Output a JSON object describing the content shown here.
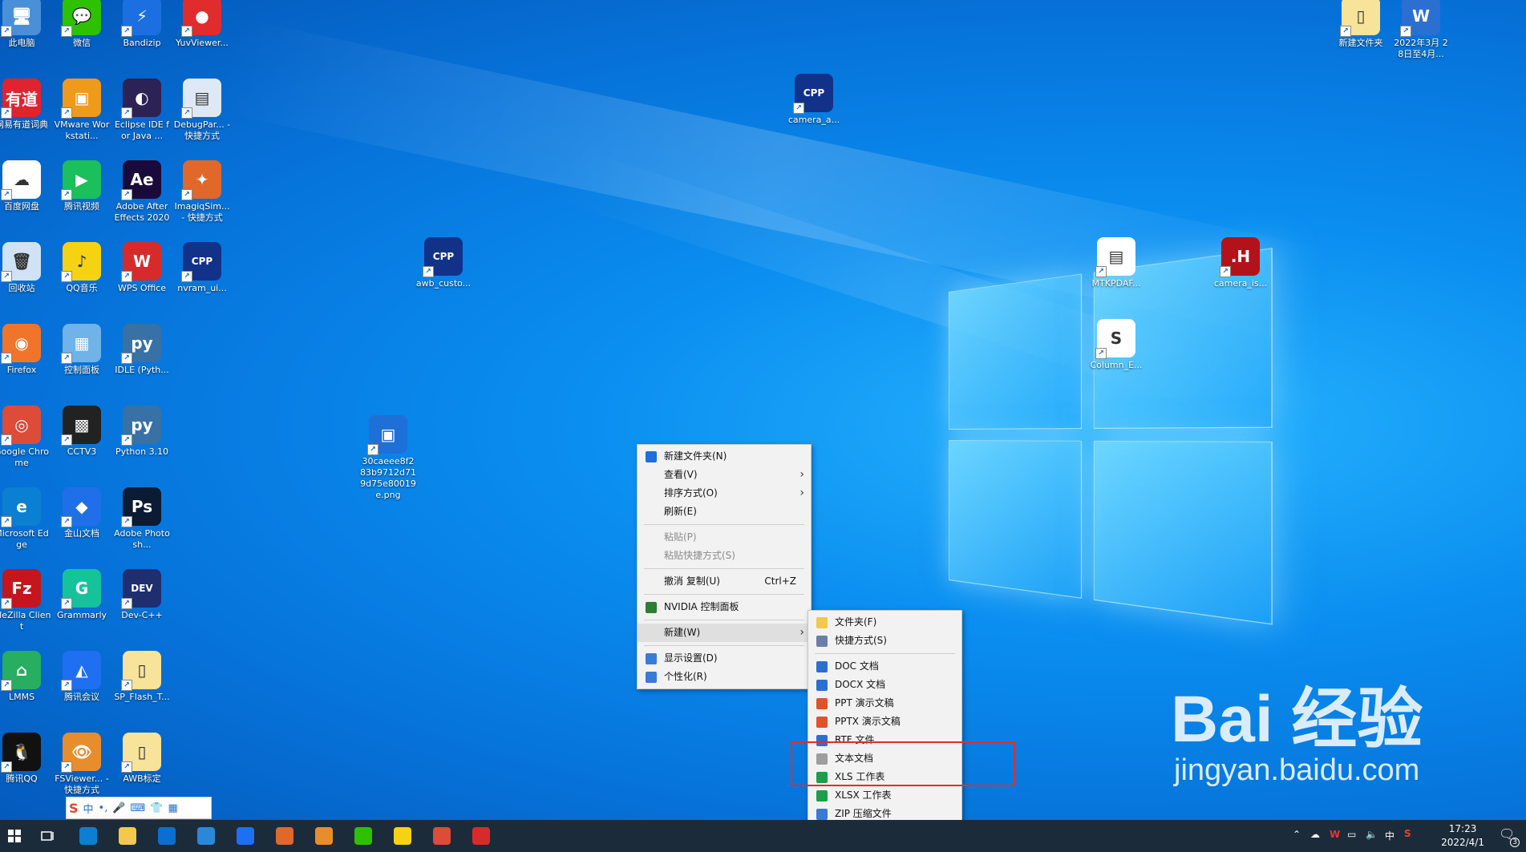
{
  "desktop_icons": [
    {
      "label": "此电脑",
      "color": "#4a90d9",
      "glyph": "🖥"
    },
    {
      "label": "微信",
      "color": "#2dc100",
      "glyph": "💬"
    },
    {
      "label": "Bandizip",
      "color": "#1c6fe0",
      "glyph": "⚡"
    },
    {
      "label": "YuvViewer...",
      "color": "#e02c2c",
      "glyph": "●"
    },
    {
      "label": "网易有道词典",
      "color": "#e0232e",
      "glyph": "有道"
    },
    {
      "label": "VMware Workstati...",
      "color": "#f09a1c",
      "glyph": "▣"
    },
    {
      "label": "Eclipse IDE for Java ...",
      "color": "#2c2255",
      "glyph": "◐"
    },
    {
      "label": "DebugPar... - 快捷方式",
      "color": "#dfe8f5",
      "glyph": "▤"
    },
    {
      "label": "百度网盘",
      "color": "#ffffff",
      "glyph": "☁"
    },
    {
      "label": "腾讯视频",
      "color": "#1bbf5c",
      "glyph": "▶"
    },
    {
      "label": "Adobe After Effects 2020",
      "color": "#1a0a3c",
      "glyph": "Ae"
    },
    {
      "label": "ImagiqSim... - 快捷方式",
      "color": "#e0682a",
      "glyph": "✦"
    },
    {
      "label": "回收站",
      "color": "#cfe3f5",
      "glyph": "🗑"
    },
    {
      "label": "QQ音乐",
      "color": "#f5d312",
      "glyph": "♪"
    },
    {
      "label": "WPS Office",
      "color": "#d72b2b",
      "glyph": "W"
    },
    {
      "label": "nvram_ui...",
      "color": "#12328a",
      "glyph": "CPP"
    },
    {
      "label": "Firefox",
      "color": "#f0752a",
      "glyph": "◉"
    },
    {
      "label": "控制面板",
      "color": "#6fb3e8",
      "glyph": "▦"
    },
    {
      "label": "IDLE (Pyth...",
      "color": "#3771a6",
      "glyph": "py"
    },
    {
      "label": "Google Chrome",
      "color": "#dd4b39",
      "glyph": "◎"
    },
    {
      "label": "CCTV3",
      "color": "#222222",
      "glyph": "▩"
    },
    {
      "label": "Python 3.10",
      "color": "#3771a6",
      "glyph": "py"
    },
    {
      "label": "Microsoft Edge",
      "color": "#0b7fd1",
      "glyph": "e"
    },
    {
      "label": "金山文档",
      "color": "#1f6fe8",
      "glyph": "◆"
    },
    {
      "label": "Adobe Photosh...",
      "color": "#0a1b33",
      "glyph": "Ps"
    },
    {
      "label": "FileZilla Client",
      "color": "#c4161c",
      "glyph": "Fz"
    },
    {
      "label": "Grammarly",
      "color": "#15c39a",
      "glyph": "G"
    },
    {
      "label": "Dev-C++",
      "color": "#1e2e6e",
      "glyph": "DEV"
    },
    {
      "label": "LMMS",
      "color": "#27ae60",
      "glyph": "⌂"
    },
    {
      "label": "腾讯会议",
      "color": "#1e6ff2",
      "glyph": "◭"
    },
    {
      "label": "SP_Flash_T...",
      "color": "#f7e39a",
      "glyph": "▯"
    },
    {
      "label": "腾讯QQ",
      "color": "#111111",
      "glyph": "🐧"
    },
    {
      "label": "FSViewer... - 快捷方式",
      "color": "#e88d2c",
      "glyph": "👁"
    },
    {
      "label": "AWB标定",
      "color": "#f7e39a",
      "glyph": "▯"
    },
    {
      "label": "camera_a...",
      "color": "#12328a",
      "glyph": "CPP"
    },
    {
      "label": "awb_custo...",
      "color": "#12328a",
      "glyph": "CPP"
    },
    {
      "label": "30caeee8f2 83b9712d71 9d75e80019 e.png",
      "color": "#1f6fd8",
      "glyph": "▣"
    },
    {
      "label": "新建文件夹",
      "color": "#f7e39a",
      "glyph": "▯"
    },
    {
      "label": "2022年3月 28日至4月...",
      "color": "#2b6fd1",
      "glyph": "W"
    },
    {
      "label": "MTKPDAF...",
      "color": "#ffffff",
      "glyph": "▤"
    },
    {
      "label": "camera_is...",
      "color": "#b3121a",
      "glyph": ".H"
    },
    {
      "label": "Column_E...",
      "color": "#ffffff",
      "glyph": "S"
    }
  ],
  "context_menu": {
    "items": [
      {
        "label": "新建文件夹(N)",
        "icon": "folder-new-icon",
        "icon_color": "#1e6fd9"
      },
      {
        "label": "查看(V)",
        "submenu": true
      },
      {
        "label": "排序方式(O)",
        "submenu": true
      },
      {
        "label": "刷新(E)"
      },
      {
        "label": "粘贴(P)",
        "disabled": true
      },
      {
        "label": "粘贴快捷方式(S)",
        "disabled": true
      },
      {
        "label": "撤消 复制(U)",
        "shortcut": "Ctrl+Z"
      },
      {
        "label": "NVIDIA 控制面板",
        "icon": "nvidia-icon",
        "icon_color": "#2e7d32"
      },
      {
        "label": "新建(W)",
        "submenu": true
      },
      {
        "label": "显示设置(D)",
        "icon": "display-icon",
        "icon_color": "#3a7bd5"
      },
      {
        "label": "个性化(R)",
        "icon": "personalize-icon",
        "icon_color": "#3a7bd5"
      }
    ]
  },
  "new_submenu": {
    "items": [
      {
        "label": "文件夹(F)",
        "icon_color": "#f2c94c"
      },
      {
        "label": "快捷方式(S)",
        "icon_color": "#6b7fa6"
      },
      {
        "label": "DOC 文档",
        "icon_color": "#2b6fd1"
      },
      {
        "label": "DOCX 文档",
        "icon_color": "#2b6fd1"
      },
      {
        "label": "PPT 演示文稿",
        "icon_color": "#e0522b"
      },
      {
        "label": "PPTX 演示文稿",
        "icon_color": "#e0522b"
      },
      {
        "label": "RTF 文件",
        "icon_color": "#2b6fd1"
      },
      {
        "label": "文本文档",
        "icon_color": "#9e9e9e"
      },
      {
        "label": "XLS 工作表",
        "icon_color": "#1e9e4a"
      },
      {
        "label": "XLSX 工作表",
        "icon_color": "#1e9e4a"
      },
      {
        "label": "ZIP 压缩文件",
        "icon_color": "#3a7bd5"
      }
    ]
  },
  "ime_bar": {
    "mode": "中",
    "items": [
      "•,",
      "🎤",
      "⌨",
      "👕",
      "▦"
    ]
  },
  "taskbar": {
    "apps": [
      {
        "name": "edge",
        "color": "#0b7fd1"
      },
      {
        "name": "file-explorer",
        "color": "#f2c94c"
      },
      {
        "name": "store",
        "color": "#0a6fd1"
      },
      {
        "name": "mail",
        "color": "#2b88d8"
      },
      {
        "name": "pc-manager",
        "color": "#1e6ff2"
      },
      {
        "name": "imagiq",
        "color": "#e0682a"
      },
      {
        "name": "fsviewer",
        "color": "#e88d2c"
      },
      {
        "name": "wechat",
        "color": "#2dc100"
      },
      {
        "name": "qq-music",
        "color": "#f5d312"
      },
      {
        "name": "chrome",
        "color": "#dd4b39"
      },
      {
        "name": "wps",
        "color": "#d72b2b"
      }
    ],
    "tray_ime": "中",
    "clock_time": "17:23",
    "clock_date": "2022/4/1",
    "notification_count": "3"
  },
  "watermark": {
    "brand": "Bai  经验",
    "url": "jingyan.baidu.com"
  }
}
